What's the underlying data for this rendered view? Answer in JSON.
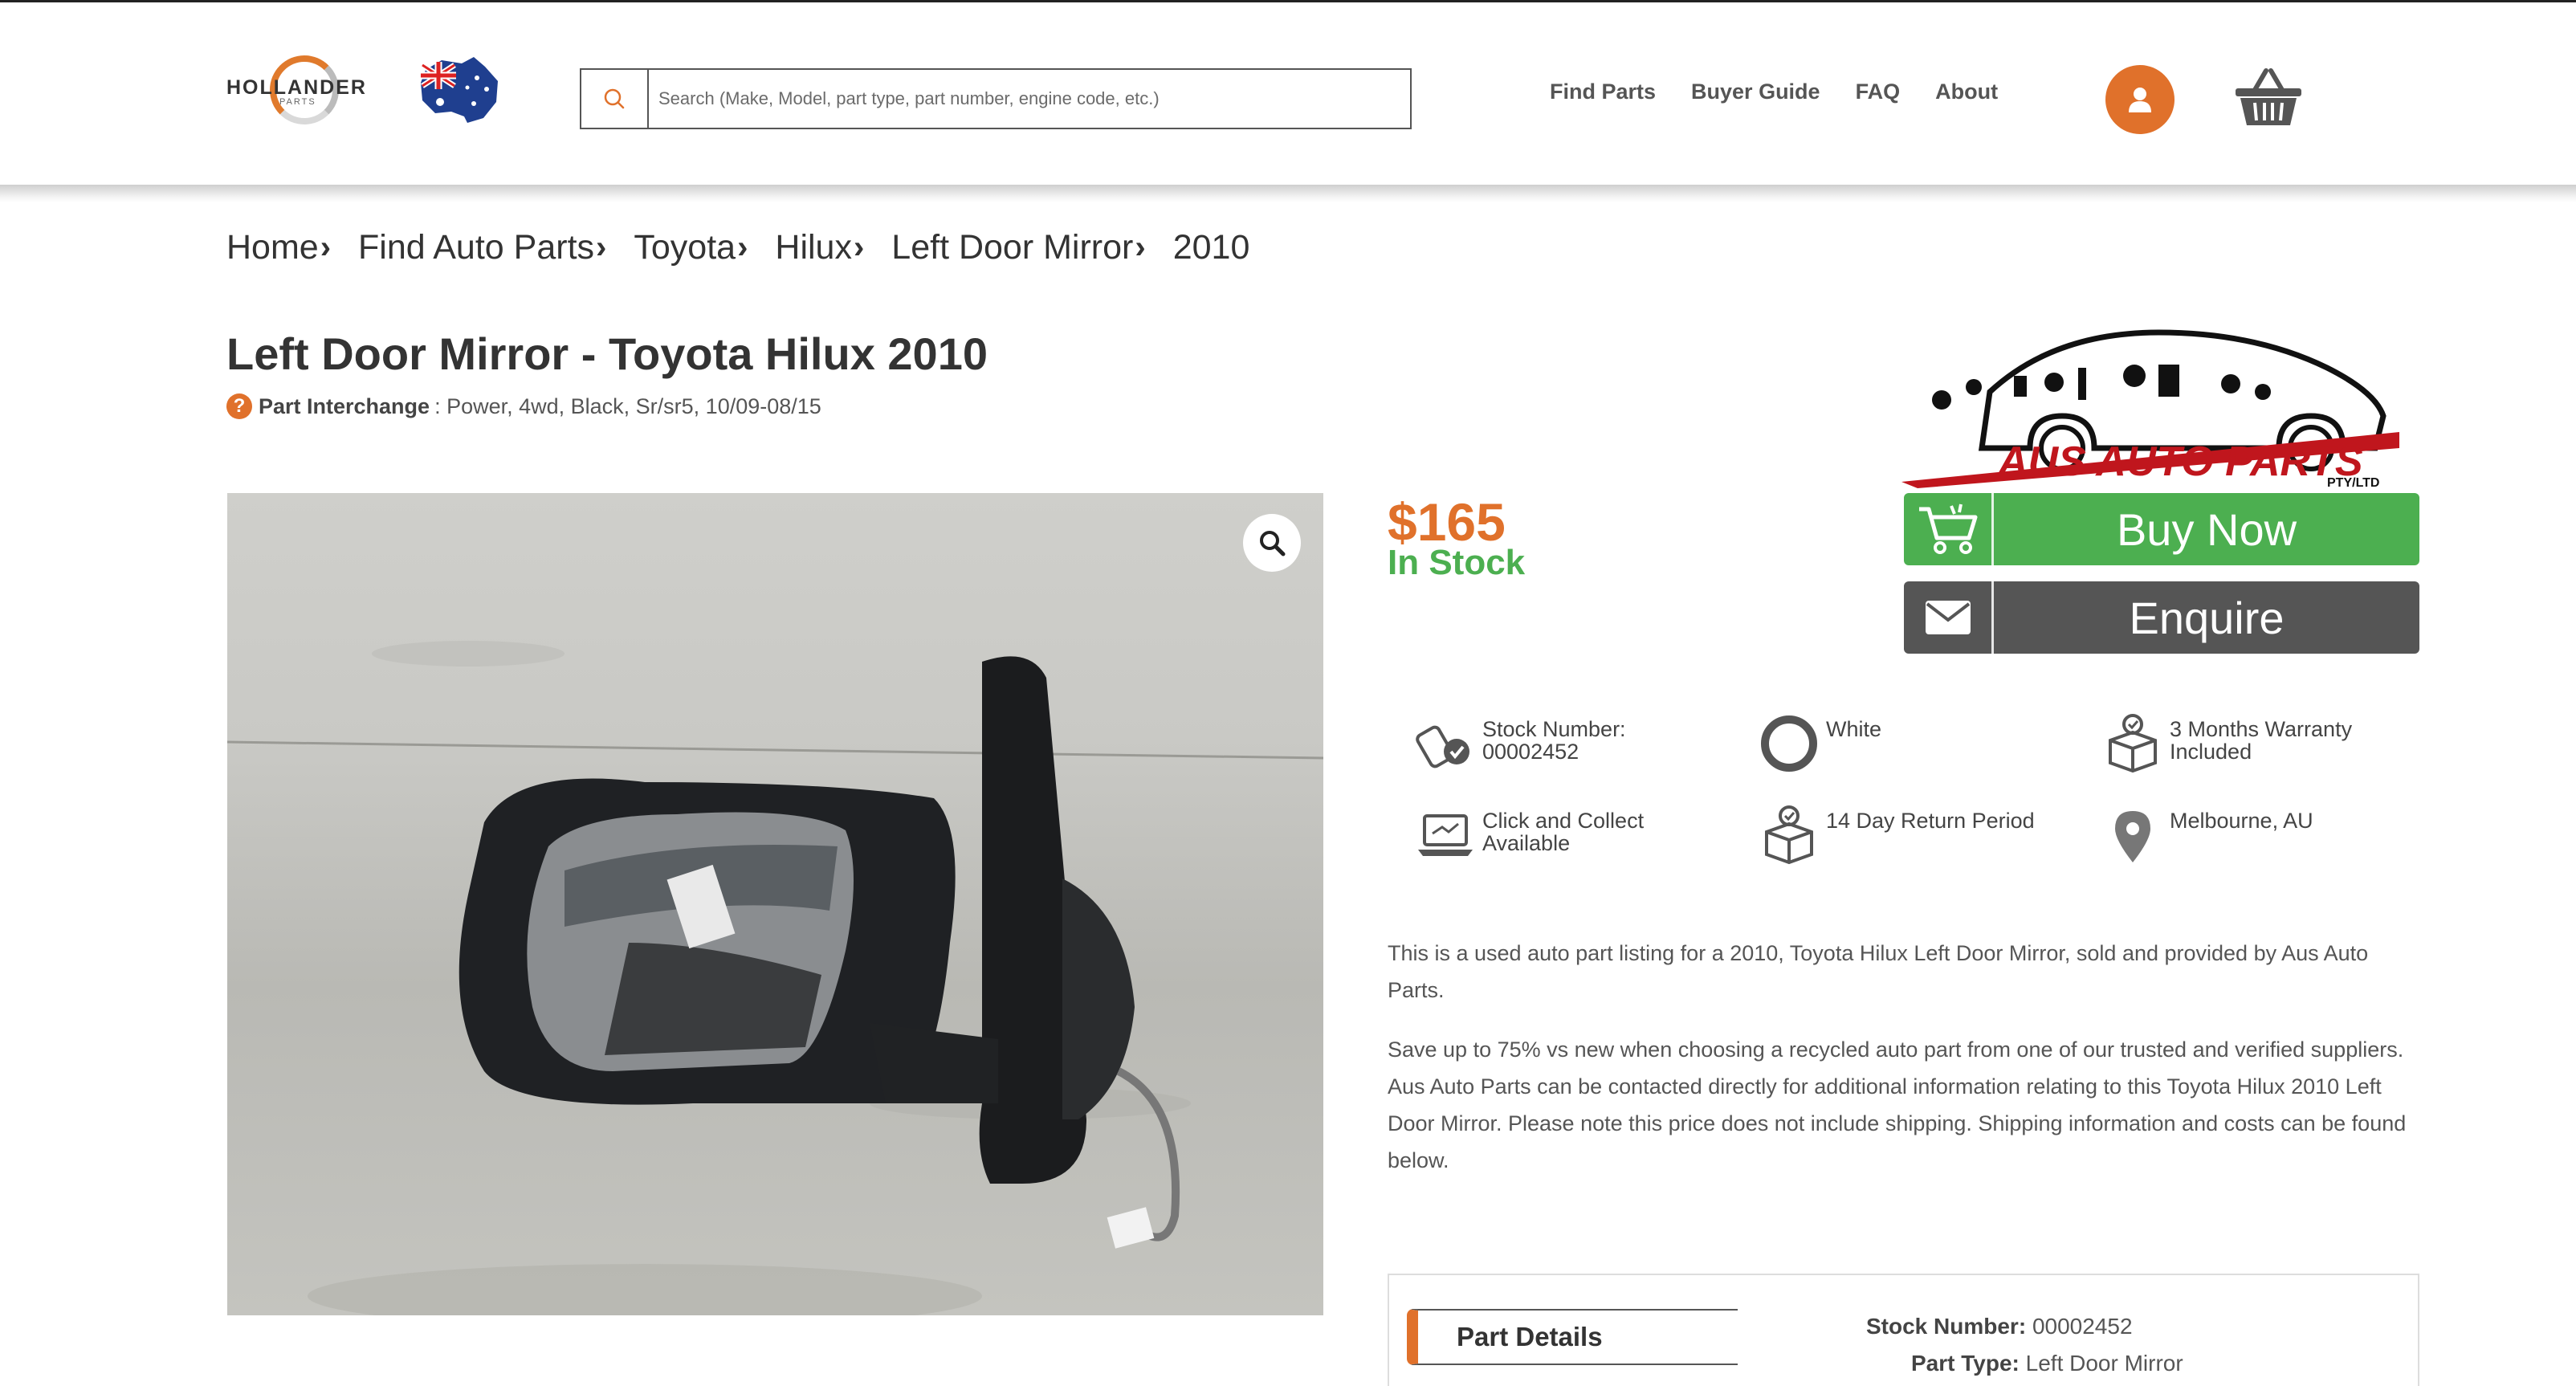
{
  "header": {
    "logo_text": "HOLLANDER",
    "logo_sub": "PARTS",
    "search_placeholder": "Search (Make, Model, part type, part number, engine code, etc.)",
    "nav": [
      "Find Parts",
      "Buyer Guide",
      "FAQ",
      "About"
    ]
  },
  "breadcrumb": [
    "Home",
    "Find Auto Parts",
    "Toyota",
    "Hilux",
    "Left Door Mirror",
    "2010"
  ],
  "product": {
    "title": "Left Door Mirror - Toyota Hilux 2010",
    "interchange_label": "Part Interchange",
    "interchange_value": ": Power, 4wd, Black, Sr/sr5, 10/09-08/15",
    "price": "$165",
    "stock_status": "In Stock"
  },
  "seller": {
    "name": "AUS AUTO PARTS",
    "suffix": "PTY/LTD"
  },
  "actions": {
    "buy": "Buy Now",
    "enquire": "Enquire"
  },
  "features": {
    "stock_line1": "Stock Number:",
    "stock_line2": "00002452",
    "color": "White",
    "warranty_line1": "3 Months Warranty",
    "warranty_line2": "Included",
    "collect_line1": "Click and Collect",
    "collect_line2": "Available",
    "returns": "14 Day Return Period",
    "location": "Melbourne, AU"
  },
  "description": {
    "p1": "This is a used auto part listing for a 2010, Toyota Hilux Left Door Mirror, sold and provided by Aus Auto Parts.",
    "p2": "Save up to 75% vs new when choosing a recycled auto part from one of our trusted and verified suppliers. Aus Auto Parts can be contacted directly for additional information relating to this Toyota Hilux 2010 Left Door Mirror. Please note this price does not include shipping. Shipping information and costs can be found below."
  },
  "details": {
    "tab_label": "Part Details",
    "rows": [
      {
        "label": "Stock Number:",
        "value": "00002452"
      },
      {
        "label": "Part Type:",
        "value": "Left Door Mirror"
      }
    ]
  },
  "colors": {
    "accent_orange": "#e0712b",
    "buy_green": "#4caf50",
    "enquire_gray": "#555555"
  }
}
